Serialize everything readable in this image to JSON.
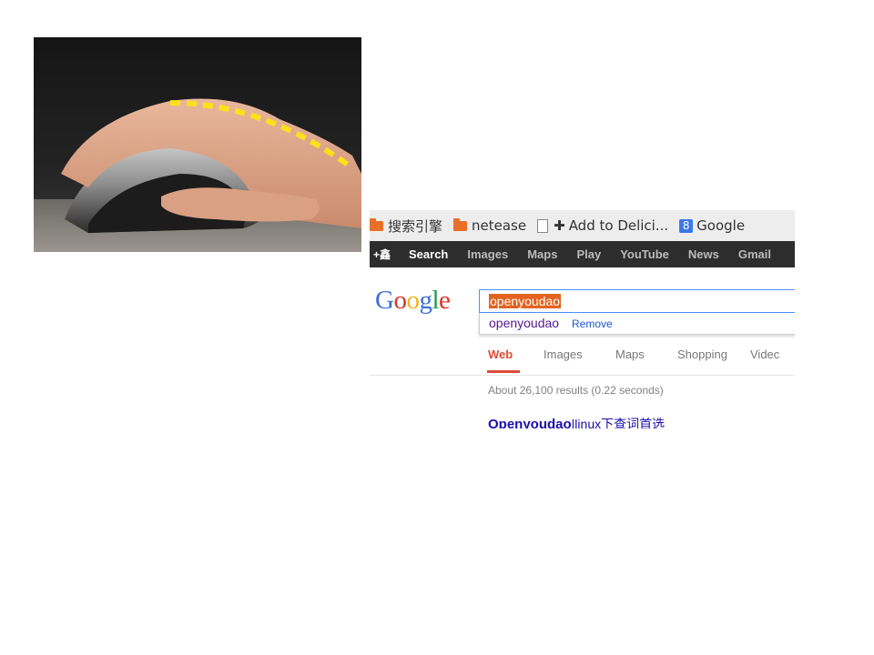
{
  "bookmarks": {
    "items": [
      {
        "label": "搜索引擎",
        "icon": "folder-icon"
      },
      {
        "label": "netease",
        "icon": "folder-icon"
      },
      {
        "label": "Add to Delici...",
        "icon": "page-icon"
      },
      {
        "label": "Google",
        "icon": "google-icon"
      }
    ]
  },
  "google_bar": {
    "plus": "+鑫",
    "items": [
      "Search",
      "Images",
      "Maps",
      "Play",
      "YouTube",
      "News",
      "Gmail"
    ]
  },
  "search": {
    "logo": "Google",
    "query": "openyoudao",
    "suggestion": "openyoudao",
    "remove_label": "Remove"
  },
  "tabs": [
    "Web",
    "Images",
    "Maps",
    "Shopping",
    "Videc"
  ],
  "results": {
    "stats": "About 26,100 results (0.22 seconds)",
    "first_title_bold": "Openyoudao",
    "first_title_rest": "|linux下查词首选"
  },
  "colors": {
    "accent_red": "#dd4b39",
    "query_highlight": "#e2631f",
    "focus_border": "#4d90fe",
    "link_blue": "#1a0dab",
    "gbar_bg": "#2d2d2d",
    "dashed_line": "#ffe01a"
  }
}
